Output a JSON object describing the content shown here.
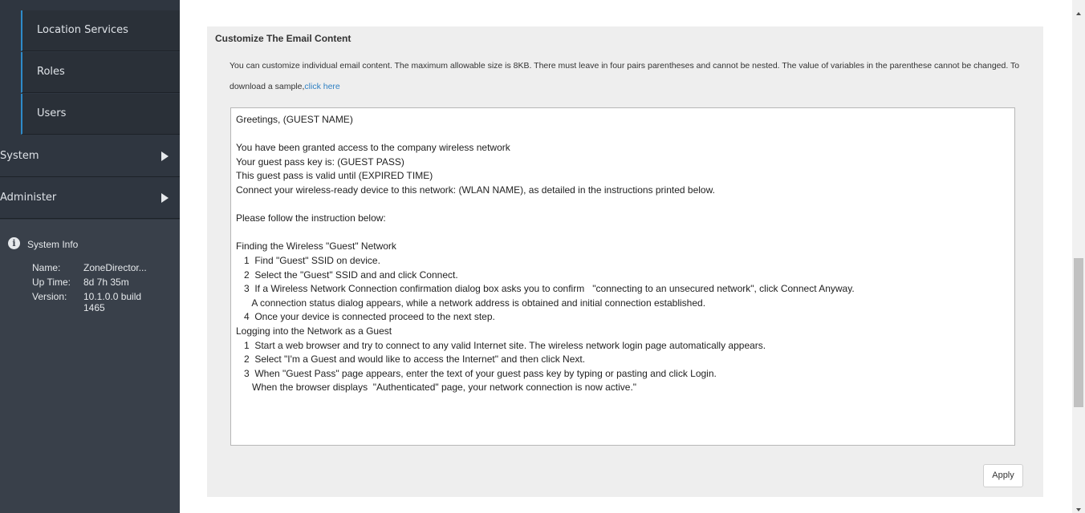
{
  "sidebar": {
    "sub_items": [
      {
        "label": "Location Services"
      },
      {
        "label": "Roles"
      },
      {
        "label": "Users"
      }
    ],
    "nav_items": [
      {
        "label": "System"
      },
      {
        "label": "Administer"
      }
    ],
    "system_info": {
      "title": "System Info",
      "name_label": "Name:",
      "name_value": "ZoneDirector...",
      "uptime_label": "Up Time:",
      "uptime_value": "8d 7h 35m",
      "version_label": "Version:",
      "version_value": "10.1.0.0 build 1465"
    }
  },
  "main": {
    "section_title": "Customize The Email Content",
    "description": "You can customize individual email content. The maximum allowable size is 8KB. There must leave in four pairs parentheses and cannot be nested. The value of variables in the parenthese cannot be changed. To download a sample,",
    "download_link": "click here",
    "email_content": "Greetings, (GUEST NAME)\n\nYou have been granted access to the company wireless network\nYour guest pass key is: (GUEST PASS)\nThis guest pass is valid until (EXPIRED TIME)\nConnect your wireless-ready device to this network: (WLAN NAME), as detailed in the instructions printed below.\n\nPlease follow the instruction below:\n\nFinding the Wireless \"Guest\" Network\n   1  Find \"Guest\" SSID on device.\n   2  Select the \"Guest\" SSID and and click Connect.\n   3  If a Wireless Network Connection confirmation dialog box asks you to confirm   \"connecting to an unsecured network\", click Connect Anyway.\n      A connection status dialog appears, while a network address is obtained and initial connection established.\n   4  Once your device is connected proceed to the next step.\nLogging into the Network as a Guest\n   1  Start a web browser and try to connect to any valid Internet site. The wireless network login page automatically appears.\n   2  Select \"I'm a Guest and would like to access the Internet\" and then click Next.\n   3  When \"Guest Pass\" page appears, enter the text of your guest pass key by typing or pasting and click Login.\n      When the browser displays  \"Authenticated\" page, your network connection is now active.\"",
    "apply_label": "Apply"
  }
}
